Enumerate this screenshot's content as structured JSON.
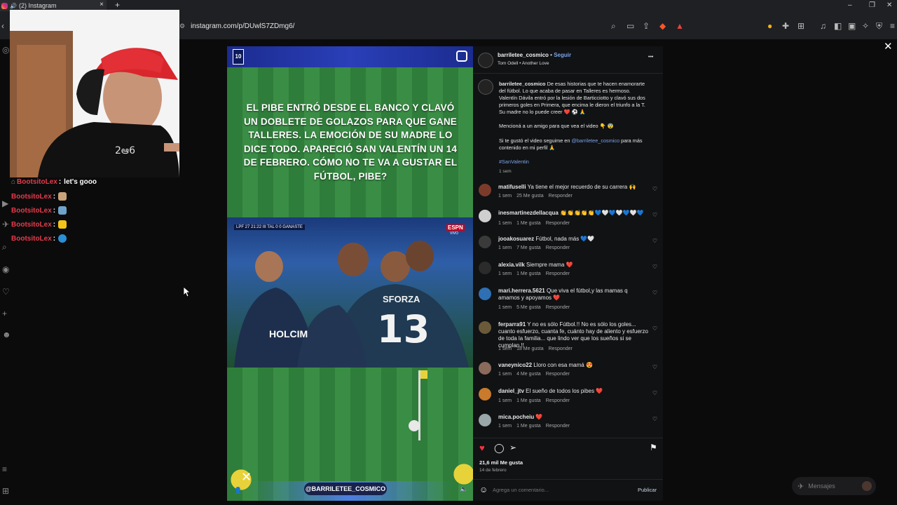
{
  "browser": {
    "tab_title": "(2) Instagram",
    "tab_close": "×",
    "new_tab": "+",
    "url": "instagram.com/p/DUwlS7ZDmg6/",
    "win_min": "–",
    "win_max": "❐",
    "win_close": "✕"
  },
  "chat": [
    {
      "user": "BootsitoLex",
      "colon": ":",
      "msg": "let's gooo",
      "emote_color": ""
    },
    {
      "user": "BootsitoLex",
      "colon": ":",
      "msg": "",
      "emote_color": "#c9a27a"
    },
    {
      "user": "BootsitoLex",
      "colon": ":",
      "msg": "",
      "emote_color": "#6fa3c9"
    },
    {
      "user": "BootsitoLex",
      "colon": ":",
      "msg": "",
      "emote_color": "#f0c419"
    },
    {
      "user": "BootsitoLex",
      "colon": ":",
      "msg": "",
      "emote_color": "#2a8fd4"
    }
  ],
  "media": {
    "headline": "EL PIBE ENTRÓ DESDE EL BANCO Y CLAVÓ UN DOBLETE DE GOLAZOS PARA QUE GANE TALLERES. LA EMOCIÓN DE SU MADRE LO DICE TODO. APARECIÓ SAN VALENTÍN UN 14 DE FEBRERO. CÓMO NO TE VA A GUSTAR EL FÚTBOL, PIBE?",
    "scoreboard": "LPF  27  21:22  III TAL  0  0 GANASTE",
    "espn": "ESPN",
    "espn_sub": "VIVO",
    "jersey_name": "SFORZA",
    "jersey_number": "13",
    "sponsor": "HOLCIM",
    "watermark": "@BARRILETEE_COSMICO"
  },
  "post": {
    "username": "barriletee_cosmico",
    "follow": "Seguir",
    "audio": "Tom Odell • Another Love",
    "more": "•••",
    "caption_user": "barriletee_cosmico",
    "caption": "De esas historias que te hacen enamorarte del fútbol. Lo que acaba de pasar en Talleres es hermoso. Valentín Dávila entró por la lesión de Barticciotto y clavó sus dos primeros goles en Primera, que encima le dieron el triunfo a la T. Su madre no lo puede creer ❤️ ⚽ 🙏",
    "caption2": "Mencioná a un amigo para que vea el video 👇 😨",
    "caption3a": "Si te gustó el video seguime en",
    "caption3_link": "@barriletee_cosmico",
    "caption3b": "para más contenido en mi perfil 🙏",
    "hashtag": "#SanValentin",
    "caption_time": "1 sem",
    "likes": "21,6 mil Me gusta",
    "date": "14 de febrero",
    "comment_placeholder": "Agrega un comentario...",
    "publish": "Publicar"
  },
  "comments": [
    {
      "user": "matifuselli",
      "text": "Ya tiene el mejor recuerdo de su carrera 🙌",
      "time": "1 sem",
      "likes": "25 Me gusta",
      "reply": "Responder",
      "color": "#7b3b2a"
    },
    {
      "user": "inesmartinezdellacqua",
      "text": "👏👏👏👏👏💙🤍💙🤍💙🤍💙",
      "time": "1 sem",
      "likes": "1 Me gusta",
      "reply": "Responder",
      "color": "#cfcfcf"
    },
    {
      "user": "jooakosuarez",
      "text": "Fútbol, nada más 💙🤍",
      "time": "1 sem",
      "likes": "7 Me gusta",
      "reply": "Responder",
      "color": "#3a3a3a"
    },
    {
      "user": "alexia.vilk",
      "text": "Siempre mama ❤️",
      "time": "1 sem",
      "likes": "1 Me gusta",
      "reply": "Responder",
      "color": "#2b2b2b"
    },
    {
      "user": "mari.herrera.5621",
      "text": "Que viva el fútbol,y las mamas q amamos y apoyamos ❤️",
      "time": "1 sem",
      "likes": "5 Me gusta",
      "reply": "Responder",
      "color": "#2f6fb3"
    },
    {
      "user": "ferparra91",
      "text": "Y no es sólo Fútbol.!! No es sólo los goles... cuanto esfuerzo, cuanta fe, cuánto hay de aliento y esfuerzo de toda la familia... que lindo ver que los sueños si se cumplan.!!",
      "time": "1 sem",
      "likes": "18 Me gusta",
      "reply": "Responder",
      "color": "#6a5a3a"
    },
    {
      "user": "vaneynico22",
      "text": "Lloro con esa mamá 😍",
      "time": "1 sem",
      "likes": "4 Me gusta",
      "reply": "Responder",
      "color": "#8a6a5a"
    },
    {
      "user": "daniel_jtv",
      "text": "El sueño de todos los pibes ❤️",
      "time": "1 sem",
      "likes": "1 Me gusta",
      "reply": "Responder",
      "color": "#c97a2a"
    },
    {
      "user": "mica.pocheiu",
      "text": "❤️",
      "time": "1 sem",
      "likes": "1 Me gusta",
      "reply": "Responder",
      "color": "#9aa6a9"
    }
  ],
  "messages": {
    "label": "Mensajes"
  }
}
